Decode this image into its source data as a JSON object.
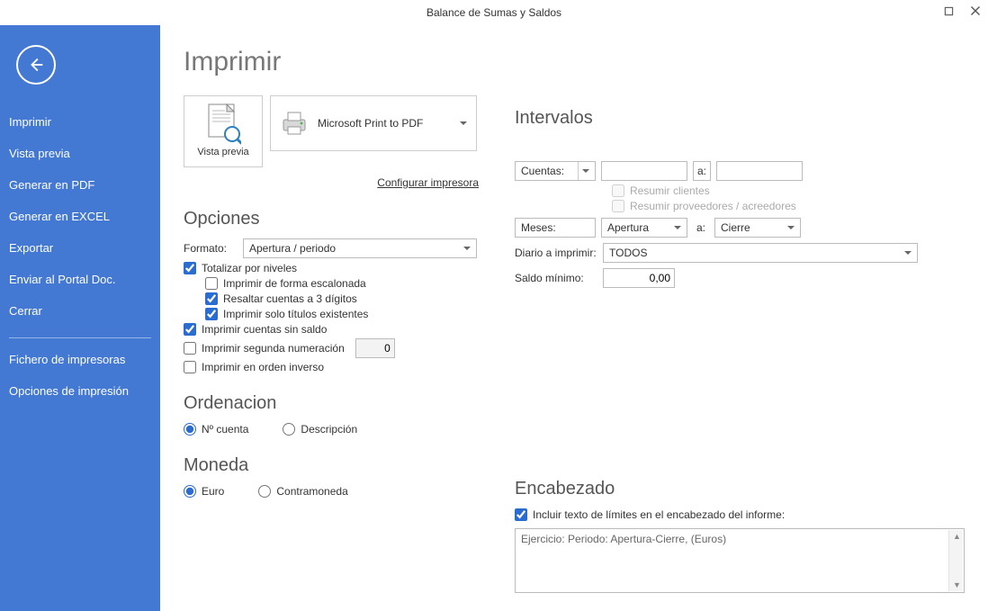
{
  "window": {
    "title": "Balance de Sumas y Saldos"
  },
  "sidebar": {
    "items": [
      {
        "label": "Imprimir"
      },
      {
        "label": "Vista previa"
      },
      {
        "label": "Generar en PDF"
      },
      {
        "label": "Generar en EXCEL"
      },
      {
        "label": "Exportar"
      },
      {
        "label": "Enviar al Portal Doc."
      },
      {
        "label": "Cerrar"
      }
    ],
    "secondary": [
      {
        "label": "Fichero de impresoras"
      },
      {
        "label": "Opciones de impresión"
      }
    ]
  },
  "page": {
    "title": "Imprimir",
    "preview_label": "Vista previa",
    "printer_name": "Microsoft Print to PDF",
    "configure_printer": "Configurar impresora"
  },
  "opciones": {
    "heading": "Opciones",
    "formato_label": "Formato:",
    "formato_value": "Apertura / periodo",
    "totalizar": "Totalizar por niveles",
    "escalonada": "Imprimir de forma escalonada",
    "resaltar3": "Resaltar cuentas a 3 dígitos",
    "solo_titulos": "Imprimir solo títulos existentes",
    "sin_saldo": "Imprimir cuentas sin saldo",
    "segunda_num": "Imprimir segunda numeración",
    "segunda_num_value": "0",
    "orden_inverso": "Imprimir en orden inverso"
  },
  "ordenacion": {
    "heading": "Ordenacion",
    "opt1": "Nº cuenta",
    "opt2": "Descripción"
  },
  "moneda": {
    "heading": "Moneda",
    "opt1": "Euro",
    "opt2": "Contramoneda"
  },
  "intervalos": {
    "heading": "Intervalos",
    "cuentas_label": "Cuentas:",
    "a_label": "a:",
    "resumir_clientes": "Resumir clientes",
    "resumir_prov": "Resumir proveedores / acreedores",
    "meses_label": "Meses:",
    "mes_from": "Apertura",
    "mes_to": "Cierre",
    "diario_label": "Diario a imprimir:",
    "diario_value": "TODOS",
    "saldo_min_label": "Saldo mínimo:",
    "saldo_min_value": "0,00"
  },
  "encabezado": {
    "heading": "Encabezado",
    "incluir_texto": "Incluir texto de límites en el encabezado del informe:",
    "content": "Ejercicio: Periodo: Apertura-Cierre, (Euros)"
  }
}
